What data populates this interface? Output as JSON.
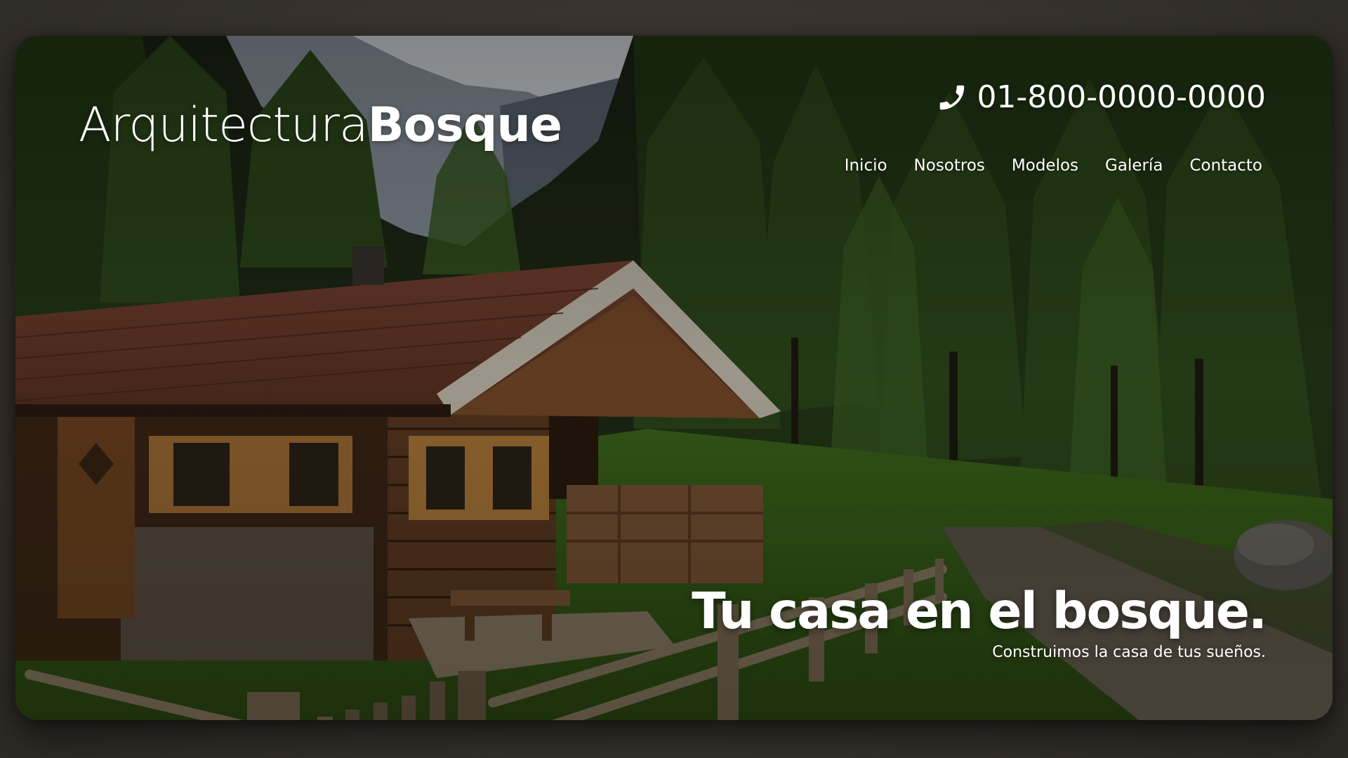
{
  "brand": {
    "name_light": "Arquitectura",
    "name_bold": "Bosque"
  },
  "contact": {
    "phone": "01-800-0000-0000",
    "icon": "phone-icon"
  },
  "nav": {
    "items": [
      "Inicio",
      "Nosotros",
      "Modelos",
      "Galería",
      "Contacto"
    ]
  },
  "hero": {
    "title": "Tu casa en el bosque.",
    "subtitle": "Construimos la casa de tus sueños."
  },
  "colors": {
    "text": "#ffffff",
    "page_background": "#3a352f",
    "forest_dark": "#1b2413",
    "roof": "#6a3a2a",
    "wood": "#6b4426",
    "grass": "#3f6a1d"
  }
}
